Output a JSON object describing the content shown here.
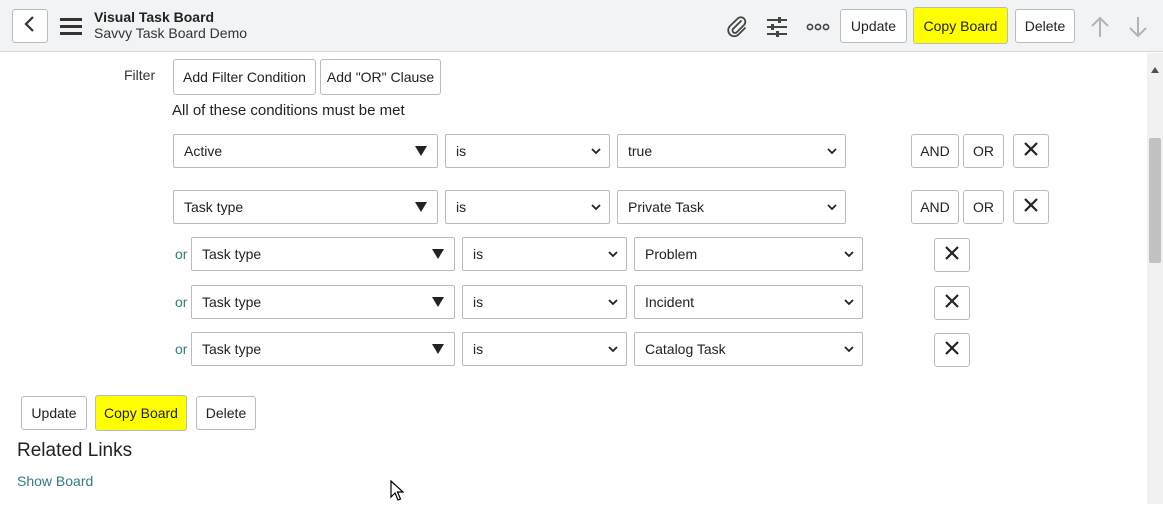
{
  "header": {
    "title": "Visual Task Board",
    "subtitle": "Savvy Task Board Demo",
    "update_label": "Update",
    "copy_label": "Copy Board",
    "delete_label": "Delete",
    "icons": [
      "chevron-left-icon",
      "hamburger-menu-icon",
      "paperclip-icon",
      "sliders-icon",
      "more-icon",
      "arrow-up-icon",
      "arrow-down-icon"
    ]
  },
  "filter": {
    "label": "Filter",
    "add_condition": "Add Filter Condition",
    "add_or": "Add \"OR\" Clause",
    "conditions_text": "All of these conditions must be met",
    "and_label": "AND",
    "or_btn_label": "OR",
    "or_prefix": "or",
    "rows": [
      {
        "field": "Active",
        "op": "is",
        "value": "true"
      },
      {
        "field": "Task type",
        "op": "is",
        "value": "Private Task"
      },
      {
        "field": "Task type",
        "op": "is",
        "value": "Problem"
      },
      {
        "field": "Task type",
        "op": "is",
        "value": "Incident"
      },
      {
        "field": "Task type",
        "op": "is",
        "value": "Catalog Task"
      }
    ]
  },
  "bottom": {
    "update_label": "Update",
    "copy_label": "Copy Board",
    "delete_label": "Delete"
  },
  "related": {
    "title": "Related Links",
    "show_board": "Show Board"
  },
  "colors": {
    "highlight": "#ffff00",
    "link": "#2e7d8a",
    "header_bg": "#f2f3f4"
  }
}
